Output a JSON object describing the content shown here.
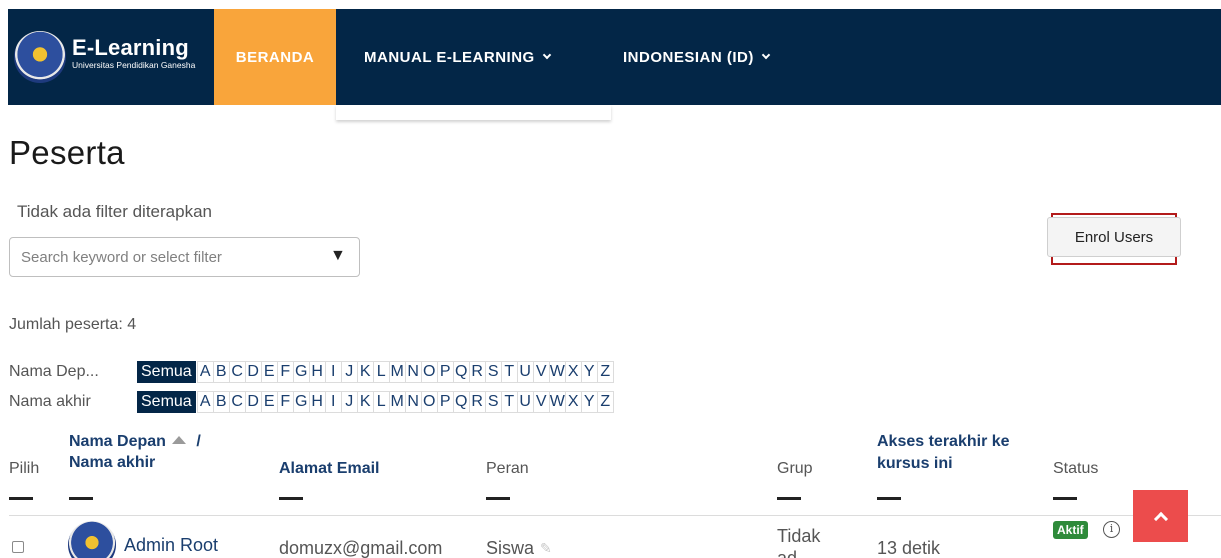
{
  "brand": {
    "title": "E-Learning",
    "subtitle": "Universitas Pendidikan Ganesha"
  },
  "nav": {
    "home": "BERANDA",
    "manual": "MANUAL E-LEARNING",
    "language": "INDONESIAN (ID)"
  },
  "page": {
    "title": "Peserta",
    "filter_label": "Tidak ada filter diterapkan",
    "search_placeholder": "Search keyword or select filter",
    "enrol_button": "Enrol Users",
    "participant_count": "Jumlah peserta: 4"
  },
  "initials": {
    "first_label": "Nama Dep...",
    "last_label": "Nama akhir",
    "all": "Semua",
    "letters": [
      "A",
      "B",
      "C",
      "D",
      "E",
      "F",
      "G",
      "H",
      "I",
      "J",
      "K",
      "L",
      "M",
      "N",
      "O",
      "P",
      "Q",
      "R",
      "S",
      "T",
      "U",
      "V",
      "W",
      "X",
      "Y",
      "Z"
    ]
  },
  "table": {
    "headers": {
      "select": "Pilih",
      "first_name": "Nama Depan",
      "sep": "/",
      "last_name": "Nama akhir",
      "email": "Alamat Email",
      "role": "Peran",
      "group": "Grup",
      "access_line1": "Akses terakhir ke",
      "access_line2": "kursus ini",
      "status": "Status"
    },
    "rows": [
      {
        "name": "Admin Root",
        "email": "domuzx@gmail.com",
        "role": "Siswa",
        "group_line1": "Tidak",
        "group_line2": "ad",
        "access": "13 detik",
        "status": "Aktif"
      }
    ]
  },
  "colors": {
    "navbar": "#032647",
    "accent": "#f9a53b",
    "scroll_top": "#ec4c4c",
    "status_active": "#2e8b3a"
  }
}
